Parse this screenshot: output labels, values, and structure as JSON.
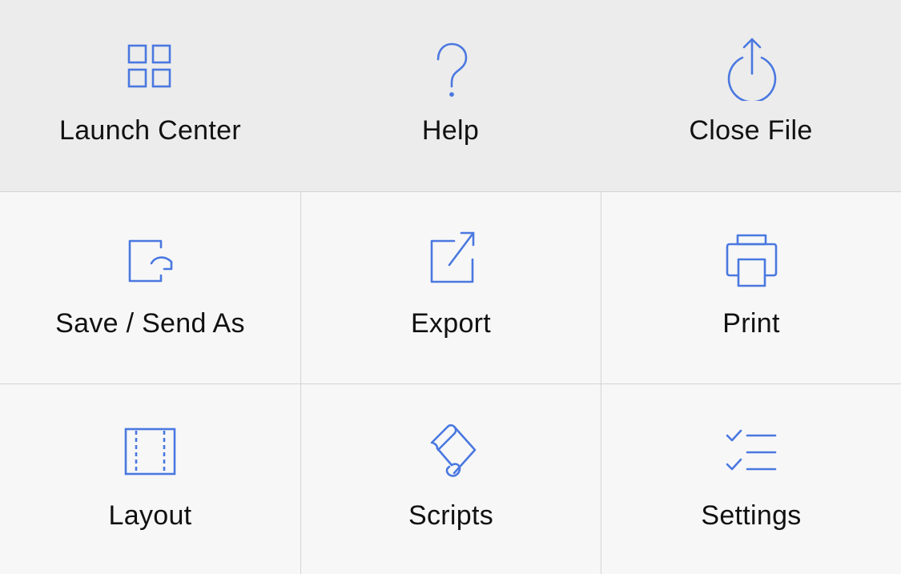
{
  "accent_color": "#4a78e0",
  "top": {
    "items": [
      {
        "label": "Launch Center",
        "icon": "grid-icon"
      },
      {
        "label": "Help",
        "icon": "question-icon"
      },
      {
        "label": "Close File",
        "icon": "power-up-arrow-icon"
      }
    ]
  },
  "grid": {
    "items": [
      {
        "label": "Save / Send As",
        "icon": "save-send-icon"
      },
      {
        "label": "Export",
        "icon": "export-icon"
      },
      {
        "label": "Print",
        "icon": "printer-icon"
      },
      {
        "label": "Layout",
        "icon": "layout-icon"
      },
      {
        "label": "Scripts",
        "icon": "scroll-icon"
      },
      {
        "label": "Settings",
        "icon": "checklist-icon"
      }
    ]
  }
}
